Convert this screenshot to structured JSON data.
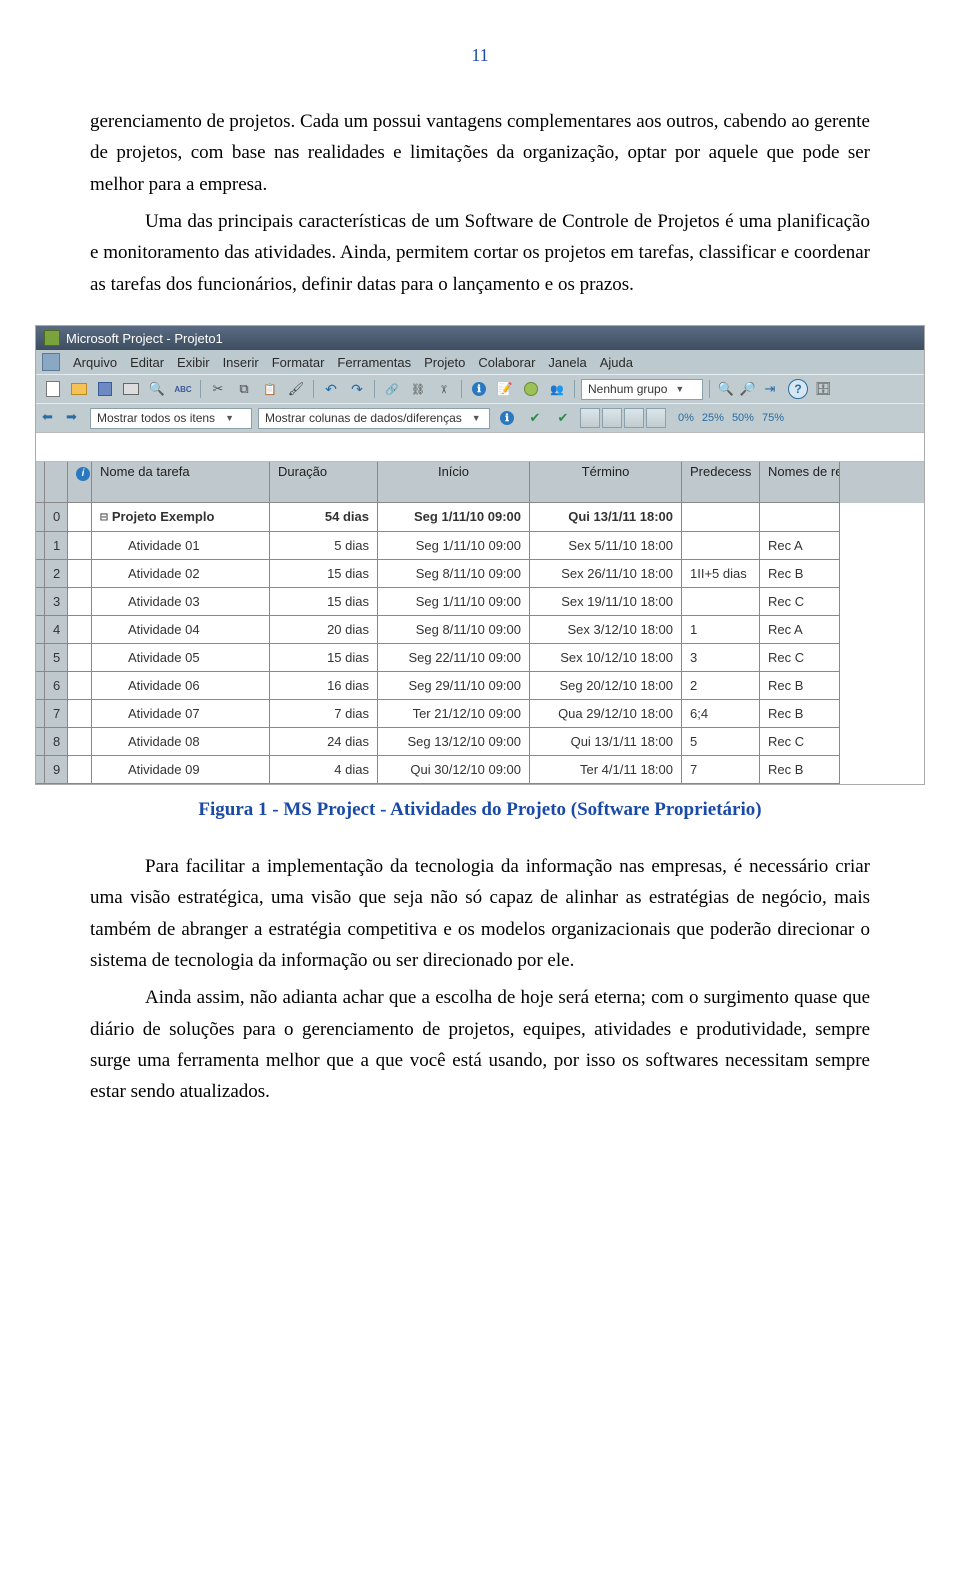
{
  "page_number": "11",
  "paragraphs": {
    "p1": "gerenciamento de projetos. Cada um possui vantagens complementares aos outros, cabendo ao gerente de projetos, com base nas realidades e limitações da organização, optar por aquele que pode ser melhor para a empresa.",
    "p2": "Uma das principais características de um Software de Controle de Projetos é uma planificação e monitoramento das atividades. Ainda, permitem cortar os projetos em tarefas, classificar e coordenar as tarefas dos funcionários, definir datas para o lançamento e os prazos.",
    "p3": "Para facilitar a implementação da tecnologia da informação nas empresas, é necessário criar uma visão estratégica, uma visão que seja não só capaz de alinhar as estratégias de negócio, mais também de abranger a estratégia competitiva e os modelos organizacionais que poderão direcionar o sistema de tecnologia da informação ou ser direcionado por ele.",
    "p4": "Ainda assim, não adianta achar que a escolha de hoje será eterna; com o surgimento quase que diário de soluções para o gerenciamento de projetos, equipes, atividades e produtividade, sempre surge uma ferramenta melhor que a que você está usando, por isso os softwares necessitam sempre estar sendo atualizados."
  },
  "caption": "Figura 1 - MS Project - Atividades do Projeto (Software Proprietário)",
  "msproject": {
    "title": "Microsoft Project - Projeto1",
    "menu": [
      "Arquivo",
      "Editar",
      "Exibir",
      "Inserir",
      "Formatar",
      "Ferramentas",
      "Projeto",
      "Colaborar",
      "Janela",
      "Ajuda"
    ],
    "group_filter": "Nenhum grupo",
    "filter_items": "Mostrar todos os itens",
    "filter_cols": "Mostrar colunas de dados/diferenças",
    "percents": [
      "0%",
      "25%",
      "50%",
      "75%"
    ],
    "columns": [
      "Nome da tarefa",
      "Duração",
      "Início",
      "Término",
      "Predecess",
      "Nomes de recursos"
    ],
    "summary": {
      "id": "0",
      "name": "Projeto Exemplo",
      "duration": "54 dias",
      "start": "Seg 1/11/10 09:00",
      "end": "Qui 13/1/11 18:00"
    },
    "rows": [
      {
        "id": "1",
        "name": "Atividade 01",
        "duration": "5 dias",
        "start": "Seg 1/11/10 09:00",
        "end": "Sex 5/11/10 18:00",
        "pred": "",
        "res": "Rec A"
      },
      {
        "id": "2",
        "name": "Atividade 02",
        "duration": "15 dias",
        "start": "Seg 8/11/10 09:00",
        "end": "Sex 26/11/10 18:00",
        "pred": "1II+5 dias",
        "res": "Rec B"
      },
      {
        "id": "3",
        "name": "Atividade 03",
        "duration": "15 dias",
        "start": "Seg 1/11/10 09:00",
        "end": "Sex 19/11/10 18:00",
        "pred": "",
        "res": "Rec C"
      },
      {
        "id": "4",
        "name": "Atividade 04",
        "duration": "20 dias",
        "start": "Seg 8/11/10 09:00",
        "end": "Sex 3/12/10 18:00",
        "pred": "1",
        "res": "Rec A"
      },
      {
        "id": "5",
        "name": "Atividade 05",
        "duration": "15 dias",
        "start": "Seg 22/11/10 09:00",
        "end": "Sex 10/12/10 18:00",
        "pred": "3",
        "res": "Rec C"
      },
      {
        "id": "6",
        "name": "Atividade 06",
        "duration": "16 dias",
        "start": "Seg 29/11/10 09:00",
        "end": "Seg 20/12/10 18:00",
        "pred": "2",
        "res": "Rec B"
      },
      {
        "id": "7",
        "name": "Atividade 07",
        "duration": "7 dias",
        "start": "Ter 21/12/10 09:00",
        "end": "Qua 29/12/10 18:00",
        "pred": "6;4",
        "res": "Rec B"
      },
      {
        "id": "8",
        "name": "Atividade 08",
        "duration": "24 dias",
        "start": "Seg 13/12/10 09:00",
        "end": "Qui 13/1/11 18:00",
        "pred": "5",
        "res": "Rec C"
      },
      {
        "id": "9",
        "name": "Atividade 09",
        "duration": "4 dias",
        "start": "Qui 30/12/10 09:00",
        "end": "Ter 4/1/11 18:00",
        "pred": "7",
        "res": "Rec B"
      }
    ]
  }
}
